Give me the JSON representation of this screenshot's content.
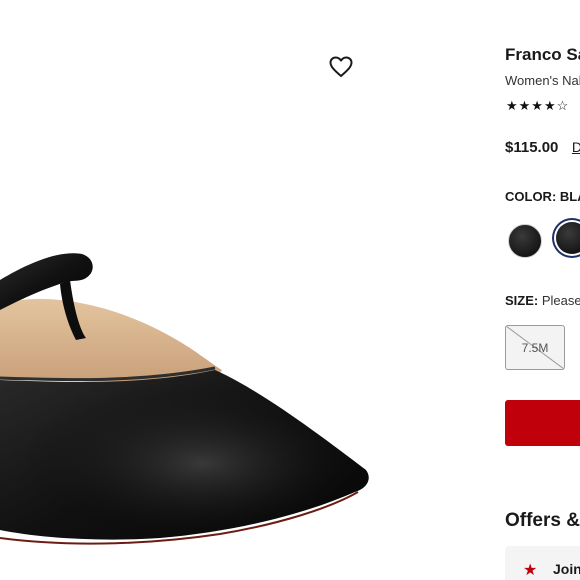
{
  "product": {
    "brand": "Franco Sa",
    "subtitle": "Women's Nal",
    "rating_stars": "★★★★☆",
    "rating": 4,
    "price": "$115.00",
    "price_link": "De"
  },
  "color": {
    "label": "COLOR:",
    "value": "BLA",
    "swatches": [
      "black-swatch-1",
      "black-swatch-2-selected"
    ]
  },
  "size": {
    "label": "SIZE:",
    "prompt": "Please",
    "options": [
      {
        "label": "7.5M",
        "available": false
      }
    ]
  },
  "offers": {
    "heading": "Offers &",
    "promo_text": "Join",
    "promo_icon": "★"
  },
  "colors": {
    "accent_red": "#c0000b",
    "selected_ring": "#1f2f6b",
    "shoe": "#141414",
    "lining": "#d8b48c"
  }
}
